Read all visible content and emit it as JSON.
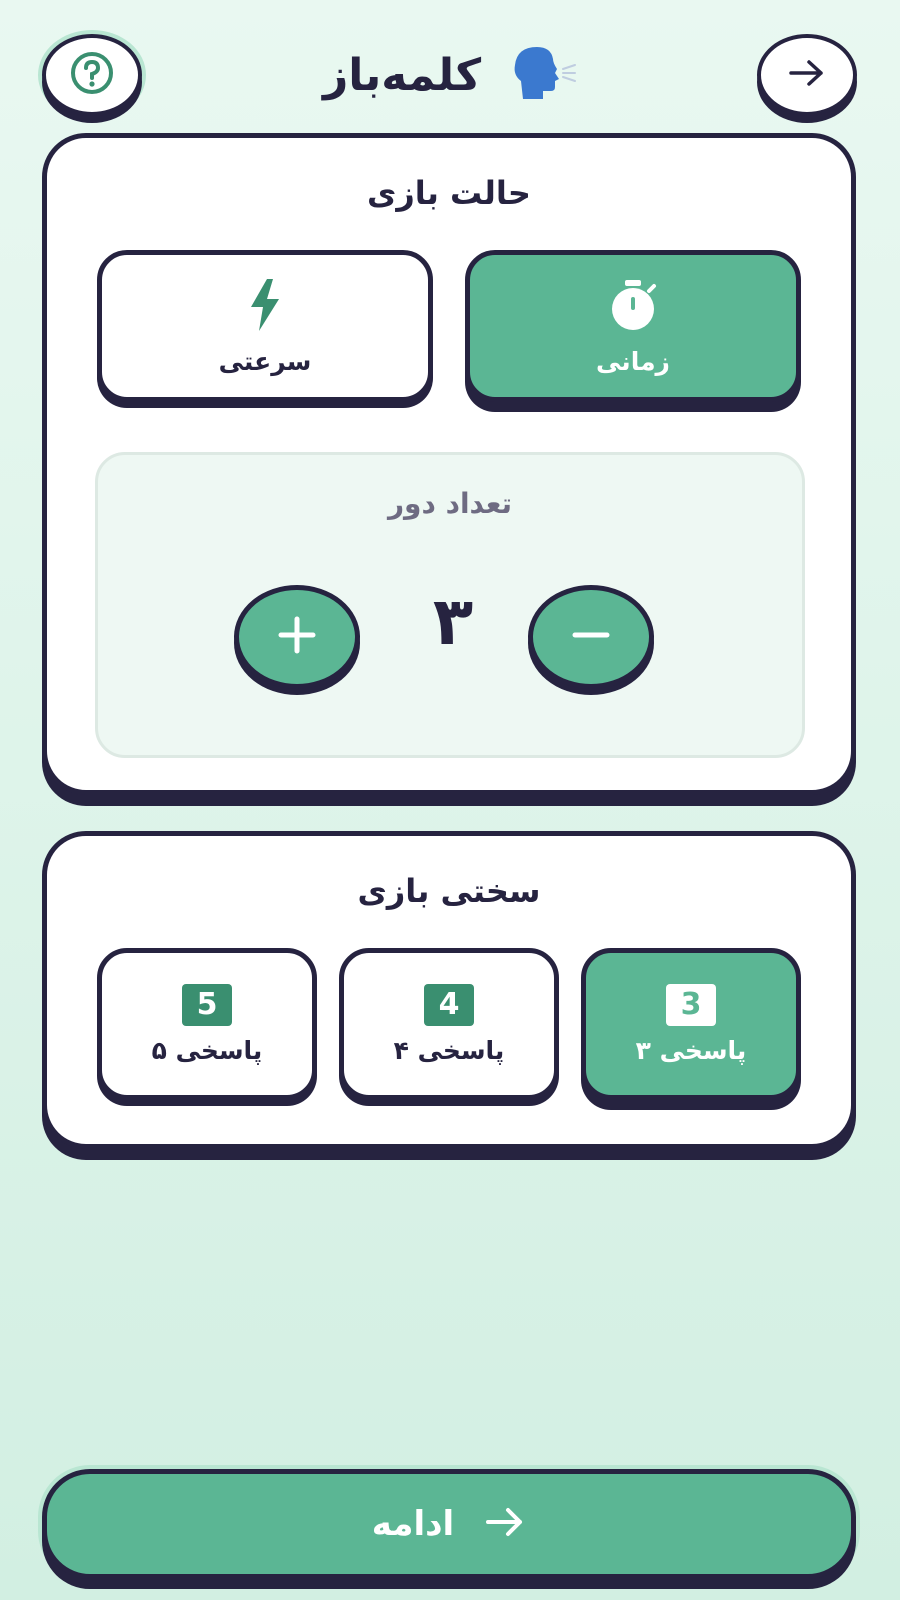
{
  "header": {
    "title": "کلمه‌باز",
    "help_icon": "question-circle-icon",
    "back_icon": "arrow-right-icon",
    "logo_icon": "speaking-head-icon"
  },
  "mode_card": {
    "title": "حالت بازی",
    "options": [
      {
        "label": "زمانی",
        "icon": "stopwatch-icon",
        "selected": true
      },
      {
        "label": "سرعتی",
        "icon": "lightning-icon",
        "selected": false
      }
    ],
    "rounds": {
      "title": "تعداد دور",
      "value": "۳",
      "decrement_icon": "minus-icon",
      "increment_icon": "plus-icon"
    }
  },
  "difficulty_card": {
    "title": "سختی بازی",
    "options": [
      {
        "badge": "3",
        "label": "۳ پاسخی",
        "selected": true
      },
      {
        "badge": "4",
        "label": "۴ پاسخی",
        "selected": false
      },
      {
        "badge": "5",
        "label": "۵ پاسخی",
        "selected": false
      }
    ]
  },
  "footer": {
    "continue_label": "ادامه",
    "continue_icon": "arrow-right-icon"
  },
  "colors": {
    "accent": "#5bb694",
    "accent_dark": "#3a8f70",
    "ink": "#262340",
    "muted": "#6e6b82",
    "background": "#e3f6ed"
  }
}
